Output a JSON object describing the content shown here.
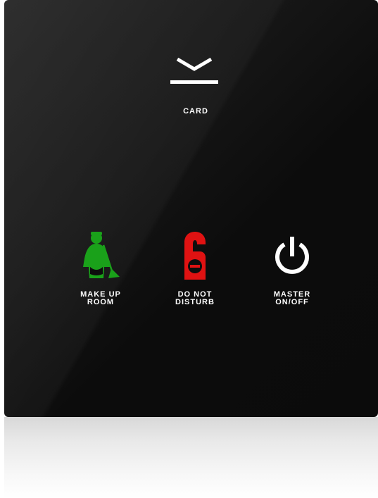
{
  "panel": {
    "card": {
      "label": "CARD",
      "icon": "card-slot-icon"
    },
    "buttons": [
      {
        "id": "make-up-room",
        "label": "MAKE UP\nROOM",
        "icon": "maid-cleaning-icon",
        "color": "#1aa11a"
      },
      {
        "id": "do-not-disturb",
        "label": "DO NOT\nDISTURB",
        "icon": "door-hanger-icon",
        "color": "#e01212"
      },
      {
        "id": "master-on-off",
        "label": "MASTER\nON/OFF",
        "icon": "power-icon",
        "color": "#ffffff"
      }
    ]
  }
}
